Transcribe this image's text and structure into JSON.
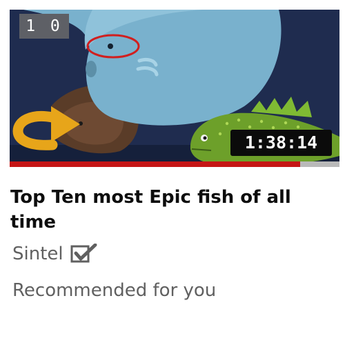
{
  "video": {
    "rank": "1 0",
    "duration": "1:38:14",
    "progress_fraction": 0.88,
    "title": "Top Ten most Epic fish of all time",
    "channel": "Sintel",
    "recommendation": "Recommended for you"
  },
  "icons": {
    "verified": "verified-check-icon"
  },
  "colors": {
    "progress": "#c51515",
    "progress_track": "#b9b9b9",
    "badge_background": "#0b0b0b",
    "rank_background": "#5e6066",
    "title_text": "#0d0d0d",
    "meta_text": "#606060"
  }
}
